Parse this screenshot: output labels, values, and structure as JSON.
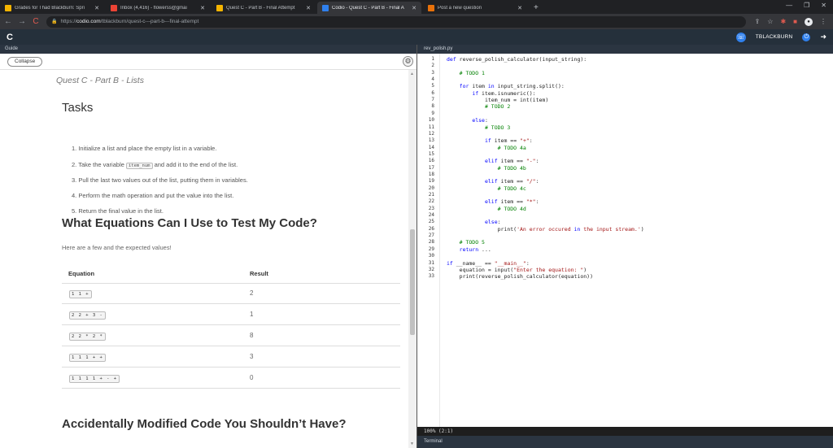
{
  "browser": {
    "tabs": [
      {
        "title": "Grades for Thad Blackburn: Spri",
        "favicon_color": "#f4b400",
        "active": false
      },
      {
        "title": "Inbox (4,416) - flowerss@gmai",
        "favicon_color": "#ea4335",
        "active": false
      },
      {
        "title": "Quest C - Part B - Final Attempt",
        "favicon_color": "#f4b400",
        "active": false
      },
      {
        "title": "Codio - Quest C - Part B - Final A",
        "favicon_color": "#2f80ed",
        "active": true
      },
      {
        "title": "Post a new question",
        "favicon_color": "#e8710a",
        "active": false
      }
    ],
    "url_host": "codio.com",
    "url_prefix": "https://",
    "url_path": "/tblackburn/quest-c---part-b---final-attempt"
  },
  "header": {
    "logo": "C",
    "username": "TBLACKBURN"
  },
  "guide": {
    "tab_label": "Guide",
    "collapse_label": "Collapse",
    "page_title": "Quest C - Part B - Lists",
    "tasks_heading": "Tasks",
    "tasks": [
      {
        "pre": "1. Initialize a list and place the empty list in a variable.",
        "code": "",
        "post": ""
      },
      {
        "pre": "2. Take the variable ",
        "code": "item_num",
        "post": " and add it to the end of the list."
      },
      {
        "pre": "3. Pull the last two values out of the list, putting them in variables.",
        "code": "",
        "post": ""
      },
      {
        "pre": "4. Perform the math operation and put the value into the list.",
        "code": "",
        "post": ""
      },
      {
        "pre": "5. Return the final value in the list.",
        "code": "",
        "post": ""
      }
    ],
    "equations_heading": "What Equations Can I Use to Test My Code?",
    "equations_intro": "Here are a few and the expected values!",
    "table_headers": {
      "equation": "Equation",
      "result": "Result"
    },
    "table_rows": [
      {
        "equation": "1 1 +",
        "result": "2"
      },
      {
        "equation": "2 2 + 3 -",
        "result": "1"
      },
      {
        "equation": "2 2 * 2 *",
        "result": "8"
      },
      {
        "equation": "1 1 1 + +",
        "result": "3"
      },
      {
        "equation": "1 1 1 1 + - +",
        "result": "0"
      }
    ],
    "accidental_heading": "Accidentally Modified Code You Shouldn’t Have?"
  },
  "editor": {
    "tab_label": "rev_polish.py",
    "status": "100% (2:1)",
    "terminal_label": "Terminal",
    "lines": [
      {
        "n": "1",
        "text": "def reverse_polish_calculator(input_string):",
        "cls": "fnline"
      },
      {
        "n": "2",
        "text": "",
        "cls": ""
      },
      {
        "n": "3",
        "text": "    # TODO 1",
        "cls": "cm"
      },
      {
        "n": "4",
        "text": "",
        "cls": ""
      },
      {
        "n": "5",
        "text": "    for item in input_string.split():",
        "cls": ""
      },
      {
        "n": "6",
        "text": "        if item.isnumeric():",
        "cls": ""
      },
      {
        "n": "7",
        "text": "            item_num = int(item)",
        "cls": ""
      },
      {
        "n": "8",
        "text": "            # TODO 2",
        "cls": "cm"
      },
      {
        "n": "9",
        "text": "",
        "cls": ""
      },
      {
        "n": "10",
        "text": "        else:",
        "cls": ""
      },
      {
        "n": "11",
        "text": "            # TODO 3",
        "cls": "cm"
      },
      {
        "n": "12",
        "text": "",
        "cls": ""
      },
      {
        "n": "13",
        "text": "            if item == \"+\":",
        "cls": ""
      },
      {
        "n": "14",
        "text": "                # TODO 4a",
        "cls": "cm"
      },
      {
        "n": "15",
        "text": "",
        "cls": ""
      },
      {
        "n": "16",
        "text": "            elif item == \"-\":",
        "cls": ""
      },
      {
        "n": "17",
        "text": "                # TODO 4b",
        "cls": "cm"
      },
      {
        "n": "18",
        "text": "",
        "cls": ""
      },
      {
        "n": "19",
        "text": "            elif item == \"/\":",
        "cls": ""
      },
      {
        "n": "20",
        "text": "                # TODO 4c",
        "cls": "cm"
      },
      {
        "n": "21",
        "text": "",
        "cls": ""
      },
      {
        "n": "22",
        "text": "            elif item == \"*\":",
        "cls": ""
      },
      {
        "n": "23",
        "text": "                # TODO 4d",
        "cls": "cm"
      },
      {
        "n": "24",
        "text": "",
        "cls": ""
      },
      {
        "n": "25",
        "text": "            else:",
        "cls": ""
      },
      {
        "n": "26",
        "text": "                print('An error occured in the input stream.')",
        "cls": ""
      },
      {
        "n": "27",
        "text": "",
        "cls": ""
      },
      {
        "n": "28",
        "text": "    # TODO 5",
        "cls": "cm"
      },
      {
        "n": "29",
        "text": "    return ...",
        "cls": ""
      },
      {
        "n": "30",
        "text": "",
        "cls": ""
      },
      {
        "n": "31",
        "text": "if __name__ == \"__main__\":",
        "cls": ""
      },
      {
        "n": "32",
        "text": "    equation = input(\"Enter the equation: \")",
        "cls": ""
      },
      {
        "n": "33",
        "text": "    print(reverse_polish_calculator(equation))",
        "cls": ""
      }
    ]
  }
}
